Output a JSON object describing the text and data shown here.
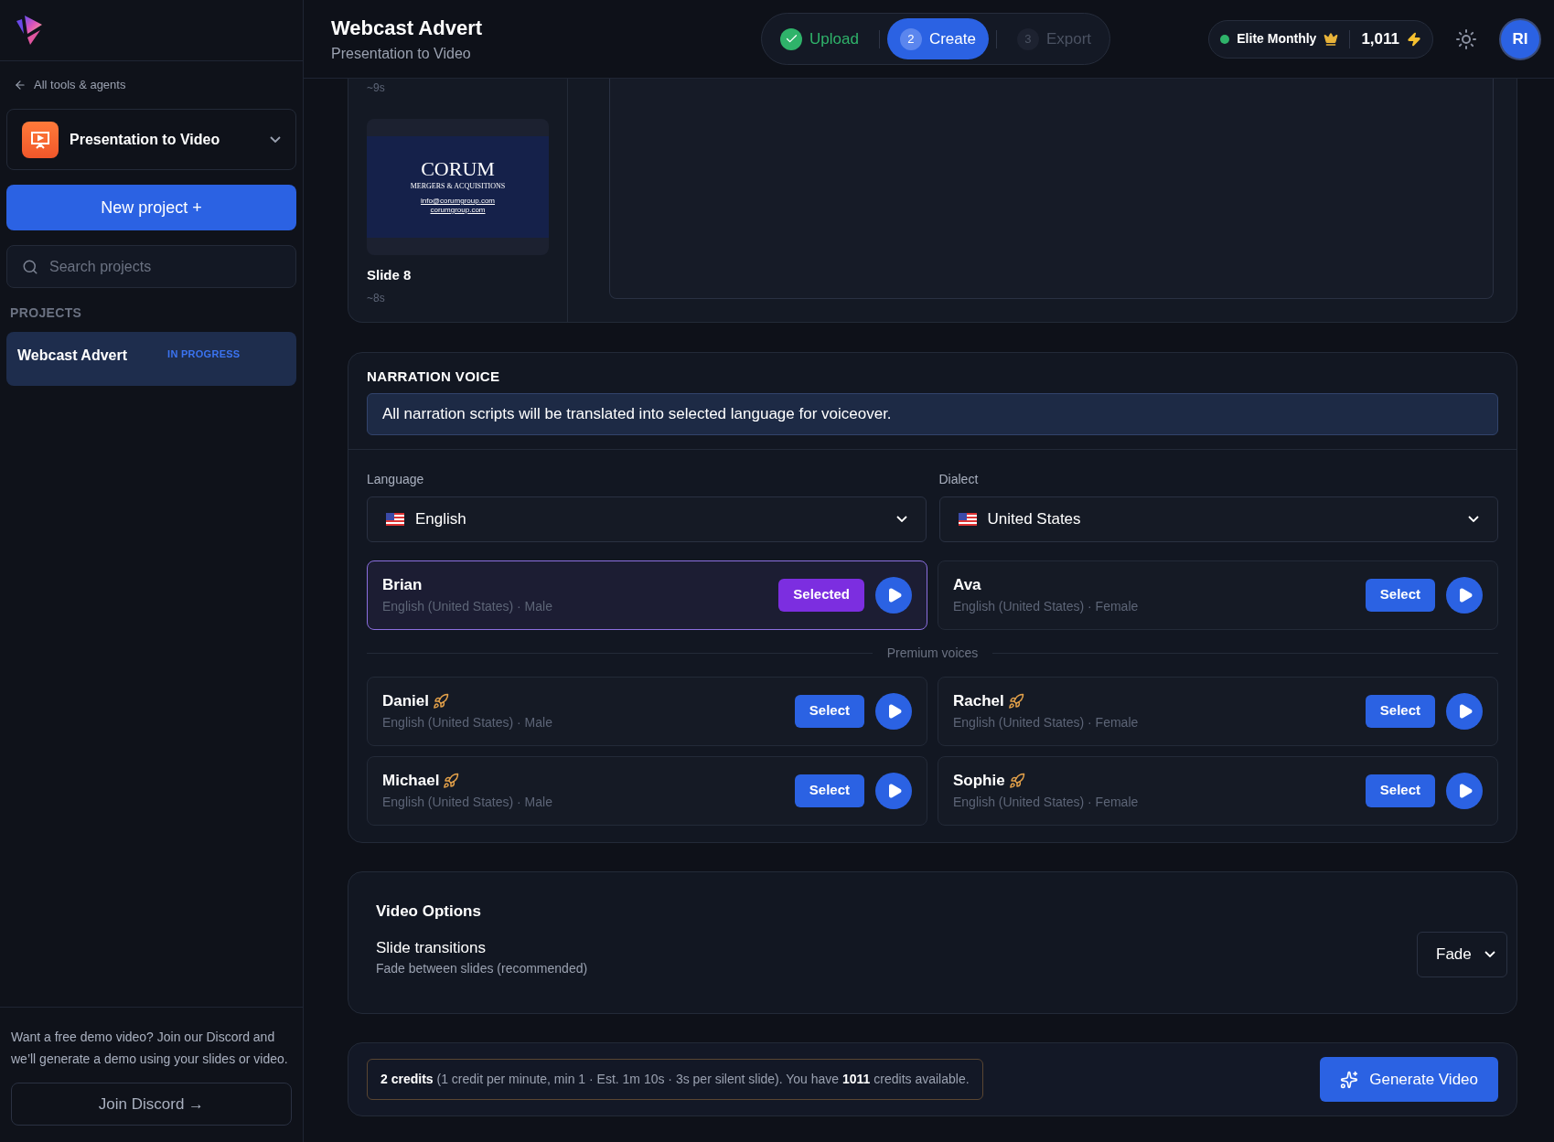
{
  "sidebar": {
    "back_link": "All tools & agents",
    "tool_selector": "Presentation to Video",
    "new_project_button": "New project +",
    "search": {
      "placeholder": "Search projects"
    },
    "projects_heading": "PROJECTS",
    "projects": [
      {
        "name": "Webcast Advert",
        "status": "IN PROGRESS",
        "selected": true
      }
    ],
    "promo": "Want a free demo video? Join our Discord and we’ll generate a demo using your slides or video.",
    "discord_button": "Join Discord →"
  },
  "header": {
    "title": "Webcast Advert",
    "subtitle": "Presentation to Video",
    "steps": [
      {
        "label": "Upload",
        "done": true,
        "selected": false
      },
      {
        "number": "2",
        "label": "Create",
        "done": false,
        "selected": true
      },
      {
        "number": "3",
        "label": "Export",
        "done": false,
        "selected": false
      }
    ],
    "plan": "Elite Monthly",
    "credits": "1,011",
    "avatar": "RI"
  },
  "slides": [
    {
      "duration": "~9s"
    },
    {
      "title": "Slide 8",
      "duration": "~8s",
      "thumbnail": {
        "title": "CORUM",
        "subtitle": "MERGERS & ACQUISITIONS",
        "lines": [
          "info@corumgroup.com",
          "corumgroup.com"
        ]
      }
    }
  ],
  "narration": {
    "heading": "NARRATION VOICE",
    "notice": "All narration scripts will be translated into selected language for voiceover.",
    "language": {
      "label": "Language",
      "value": "English"
    },
    "dialect": {
      "label": "Dialect",
      "value": "United States"
    },
    "voices": [
      {
        "name": "Brian",
        "details": "English (United States) · Male",
        "button": "Selected",
        "selected": true,
        "premium": false
      },
      {
        "name": "Ava",
        "details": "English (United States) · Female",
        "button": "Select",
        "selected": false,
        "premium": false
      }
    ],
    "premium_divider": "Premium voices",
    "premium_voices": [
      {
        "name": "Daniel",
        "details": "English (United States) · Male",
        "button": "Select",
        "selected": false,
        "premium": true
      },
      {
        "name": "Rachel",
        "details": "English (United States) · Female",
        "button": "Select",
        "selected": false,
        "premium": true
      },
      {
        "name": "Michael",
        "details": "English (United States) · Male",
        "button": "Select",
        "selected": false,
        "premium": true
      },
      {
        "name": "Sophie",
        "details": "English (United States) · Female",
        "button": "Select",
        "selected": false,
        "premium": true
      }
    ]
  },
  "video_options": {
    "heading": "Video Options",
    "settings": [
      {
        "label": "Slide transitions",
        "description": "Fade between slides (recommended)",
        "value": "Fade"
      }
    ]
  },
  "footer": {
    "summary": "**2 credits** (1 credit per minute, min 1 · Est. 1m 10s · 3s per silent slide). You have **1011** credits available.",
    "button": "Generate Video"
  }
}
